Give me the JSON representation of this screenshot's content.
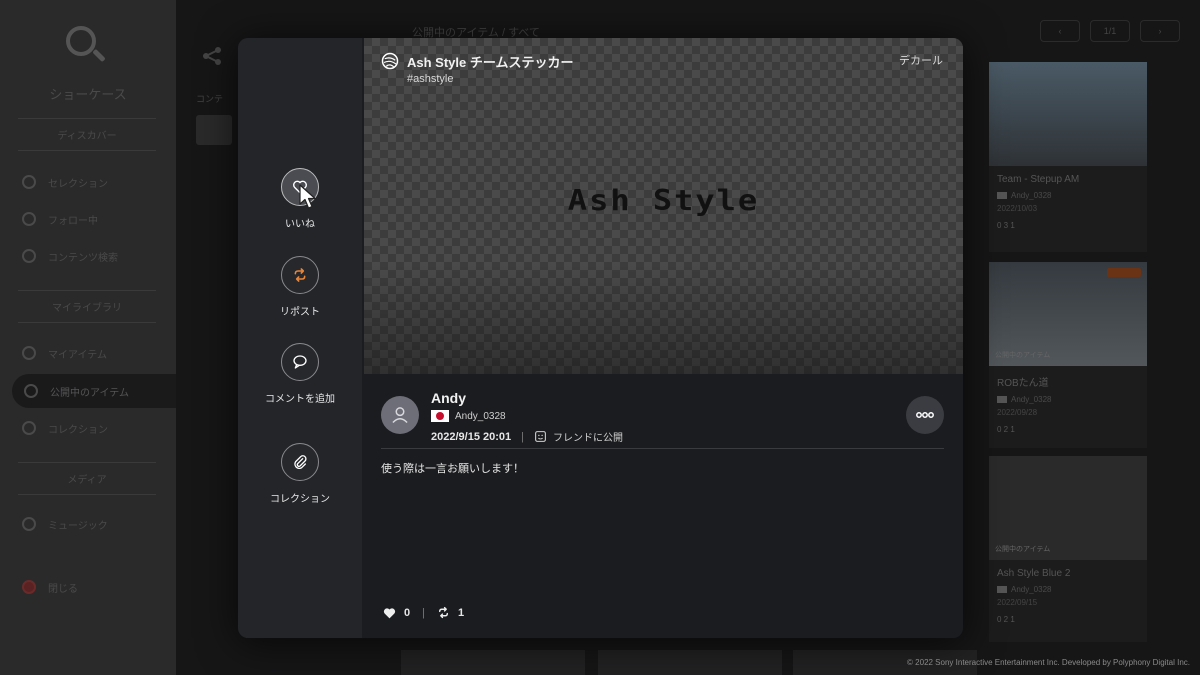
{
  "background": {
    "sidebar": {
      "title": "ショーケース",
      "sections": [
        {
          "label": "ディスカバー"
        },
        {
          "label": "マイライブラリ"
        },
        {
          "label": "メディア"
        }
      ],
      "items": [
        {
          "label": "セレクション"
        },
        {
          "label": "フォロー中"
        },
        {
          "label": "コンテンツ検索"
        },
        {
          "label": "マイアイテム"
        },
        {
          "label": "公開中のアイテム"
        },
        {
          "label": "コレクション"
        },
        {
          "label": "ミュージック"
        },
        {
          "label": "閉じる"
        }
      ]
    },
    "header": {
      "breadcrumb": "公開中のアイテム / すべて",
      "page": "1/1"
    },
    "cards": [
      {
        "title": "Team - Stepup AM",
        "user": "Andy_0328",
        "date": "2022/10/03",
        "stats": "0  3  1"
      },
      {
        "title": "ROBたん道",
        "user": "Andy_0328",
        "date": "2022/09/28",
        "stats": "0  2  1"
      },
      {
        "title": "Ash Style Blue 2",
        "user": "Andy_0328",
        "date": "2022/09/15",
        "stats": "0  2  1"
      }
    ]
  },
  "modal": {
    "actions": {
      "like": "いいね",
      "repost": "リポスト",
      "comment": "コメントを追加",
      "collection": "コレクション"
    },
    "item": {
      "title": "Ash Style チームステッカー",
      "tag": "#ashstyle",
      "category": "デカール",
      "decal_text": "Ash Style"
    },
    "author": {
      "name": "Andy",
      "id": "Andy_0328",
      "date": "2022/9/15 20:01",
      "visibility": "フレンドに公開"
    },
    "description": "使う際は一言お願いします！",
    "stats": {
      "likes": "0",
      "reposts": "1"
    }
  },
  "footer": {
    "copyright": "© 2022 Sony Interactive Entertainment Inc. Developed by Polyphony Digital Inc."
  }
}
